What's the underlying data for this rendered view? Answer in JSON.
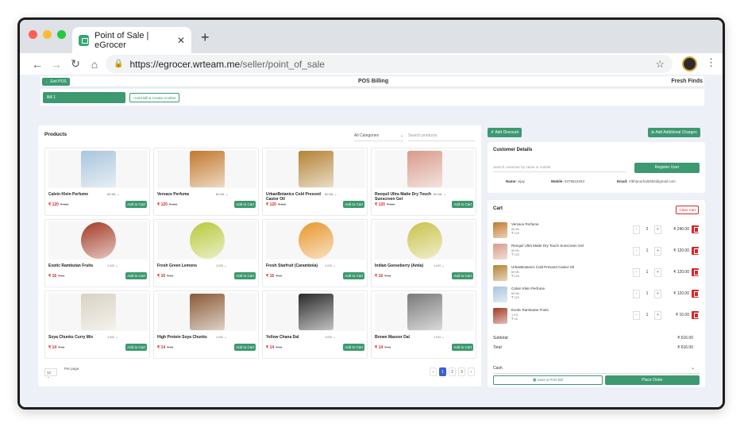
{
  "browser": {
    "tab_title": "Point of Sale | eGrocer",
    "tab_close": "✕",
    "new_tab": "+",
    "url_host": "https://egrocer.wrteam.me",
    "url_path": "/seller/point_of_sale",
    "icons": {
      "back": "back-arrow-icon",
      "forward": "forward-arrow-icon",
      "reload": "reload-icon",
      "home": "home-icon",
      "lock": "lock-icon",
      "star": "star-icon",
      "menu": "kebab-menu-icon"
    },
    "dots": [
      "#ff5f57",
      "#febc2e",
      "#28c840"
    ]
  },
  "topbar": {
    "exit_label": "Exit POS",
    "title": "POS Billing",
    "shop_name": "Fresh Finds"
  },
  "bill": {
    "tab_label": "Bill 1",
    "hold_label": "Hold Bill & Create Another"
  },
  "products": {
    "heading": "Products",
    "category_select": "All Categories",
    "search_placeholder": "Search products",
    "add_label": "Add to Cart",
    "items": [
      {
        "name": "Calvin Klein Perfume",
        "qty": "60 ML",
        "price": "₹ 120",
        "mrp": "₹ 300",
        "color": "#a9c5dc"
      },
      {
        "name": "Versace Perfume",
        "qty": "60 ML",
        "price": "₹ 120",
        "mrp": "₹ 300",
        "color": "#c2782d"
      },
      {
        "name": "UrbanBotanics Cold Pressed Castor Oil",
        "qty": "60 ML",
        "price": "₹ 120",
        "mrp": "₹ 300",
        "color": "#b38335"
      },
      {
        "name": "Reequil Ultra Matte Dry Touch Sunscreen Gel",
        "qty": "60 ML",
        "price": "₹ 120",
        "mrp": "₹ 300",
        "color": "#d89b8a"
      },
      {
        "name": "Exotic Rambutan Fruits",
        "qty": "1 KG",
        "price": "₹ 16",
        "mrp": "₹ 20",
        "color": "#a33a24"
      },
      {
        "name": "Fresh Green Lemons",
        "qty": "1 KG",
        "price": "₹ 16",
        "mrp": "₹ 20",
        "color": "#b7c93a"
      },
      {
        "name": "Fresh Starfruit (Carambola)",
        "qty": "1 KG",
        "price": "₹ 16",
        "mrp": "₹ 20",
        "color": "#e8962a"
      },
      {
        "name": "Indian Gooseberry (Amla)",
        "qty": "1 KG",
        "price": "₹ 16",
        "mrp": "₹ 20",
        "color": "#c8c24a"
      },
      {
        "name": "Soya Chunks Curry Mix",
        "qty": "1 KG",
        "price": "₹ 14",
        "mrp": "₹ 18",
        "color": "#d9d2c2"
      },
      {
        "name": "High Protein Soya Chunks",
        "qty": "1 KG",
        "price": "₹ 14",
        "mrp": "₹ 18",
        "color": "#8a5a36"
      },
      {
        "name": "Yellow Chana Dal",
        "qty": "1 KG",
        "price": "₹ 14",
        "mrp": "₹ 18",
        "color": "#2a2a2a"
      },
      {
        "name": "Brown Masoor Dal",
        "qty": "1 KG",
        "price": "₹ 14",
        "mrp": "₹ 18",
        "color": "#7a7a7a"
      }
    ],
    "per_page": "12",
    "per_page_label": "Per page",
    "pages": [
      "‹",
      "1",
      "2",
      "3",
      "›"
    ]
  },
  "actions": {
    "discount_label": "Add Discount",
    "charges_label": "Add Additional Charges"
  },
  "customer": {
    "heading": "Customer Details",
    "search_placeholder": "Search customer by name or mobile",
    "register_label": "Register User",
    "name_label": "Name:",
    "name_value": "vijay",
    "mobile_label": "Mobile:",
    "mobile_value": "6379816263",
    "email_label": "Email:",
    "email_value": "Vibhanurhal2694@gmail.com"
  },
  "cart": {
    "heading": "Cart",
    "clear_label": "Clear Cart",
    "items": [
      {
        "name": "Versace Perfume",
        "qty_unit": "60 ML",
        "price": "₹ 120",
        "quantity": "2",
        "total": "₹ 240.00",
        "color": "#c2782d"
      },
      {
        "name": "Reequil Ultra Matte Dry Touch Sunscreen Gel",
        "qty_unit": "60 ML",
        "price": "₹ 120",
        "quantity": "1",
        "total": "₹ 120.00",
        "color": "#d89b8a"
      },
      {
        "name": "UrbanBotanics Cold Pressed Castor Oil",
        "qty_unit": "60 ML",
        "price": "₹ 120",
        "quantity": "1",
        "total": "₹ 120.00",
        "color": "#b38335"
      },
      {
        "name": "Calvin Klein Perfume",
        "qty_unit": "60 ML",
        "price": "₹ 120",
        "quantity": "1",
        "total": "₹ 120.00",
        "color": "#a9c5dc"
      },
      {
        "name": "Exotic Rambutan Fruits",
        "qty_unit": "1 KG",
        "price": "₹ 16",
        "quantity": "1",
        "total": "₹ 16.00",
        "color": "#a33a24"
      }
    ],
    "subtotal_label": "Subtotal:",
    "subtotal_value": "₹ 616.00",
    "total_label": "Total:",
    "total_value": "₹ 616.00",
    "payment_method": "Cash",
    "save_print_label": "Save & Print Bill",
    "place_order_label": "Place Order"
  },
  "colors": {
    "accent": "#3d9970",
    "danger": "#d9262c",
    "page_active": "#3d5fcf"
  }
}
